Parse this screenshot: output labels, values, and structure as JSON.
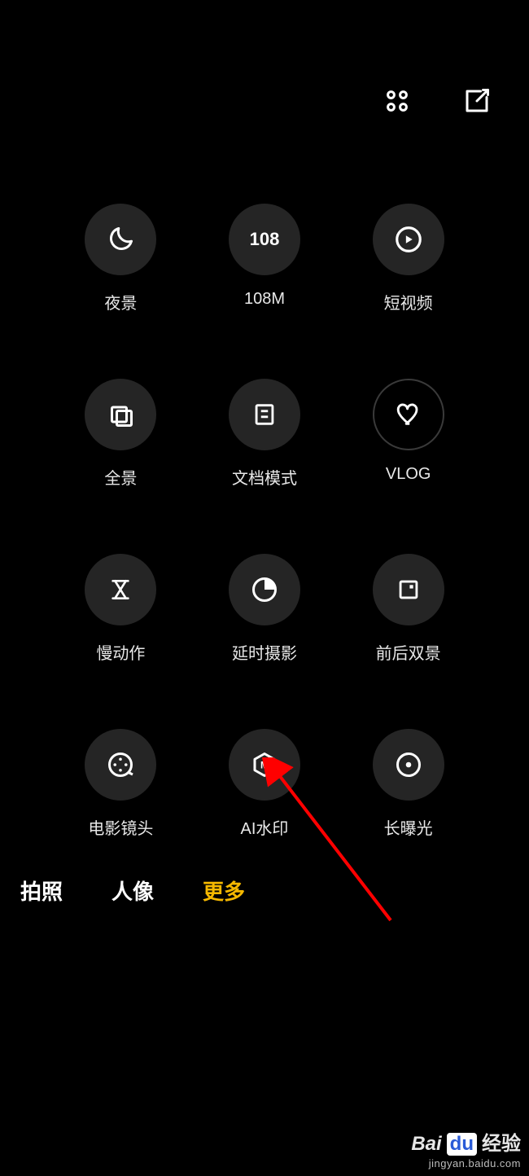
{
  "modes": {
    "night": {
      "label": "夜景"
    },
    "mp108": {
      "label": "108M",
      "text": "108"
    },
    "shortvideo": {
      "label": "短视频"
    },
    "pano": {
      "label": "全景"
    },
    "doc": {
      "label": "文档模式"
    },
    "vlog": {
      "label": "VLOG"
    },
    "slowmo": {
      "label": "慢动作"
    },
    "timelapse": {
      "label": "延时摄影"
    },
    "dualview": {
      "label": "前后双景"
    },
    "movielens": {
      "label": "电影镜头"
    },
    "aiwatermark": {
      "label": "AI水印"
    },
    "longexp": {
      "label": "长曝光"
    }
  },
  "tabs": {
    "photo": "拍照",
    "portrait": "人像",
    "more": "更多"
  },
  "watermark": {
    "brand_bai": "Bai",
    "brand_du": "du",
    "brand_suffix": "经验",
    "url": "jingyan.baidu.com"
  }
}
